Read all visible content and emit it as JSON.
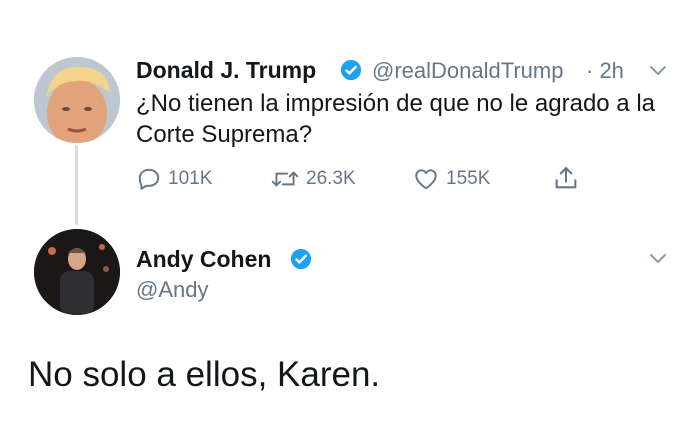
{
  "tweet": {
    "author_name": "Donald J. Trump",
    "handle": "@realDonaldTrump",
    "time": "· 2h",
    "text": "¿No tienen la impresión de que no le agrado a la Corte Suprema?",
    "replies": "101K",
    "retweets": "26.3K",
    "likes": "155K"
  },
  "reply": {
    "author_name": "Andy Cohen",
    "handle": "@Andy",
    "text": "No solo a ellos, Karen."
  },
  "icons": {
    "verified": "verified-badge-icon",
    "reply": "reply-icon",
    "retweet": "retweet-icon",
    "like": "heart-icon",
    "share": "share-icon",
    "menu": "chevron-down-icon"
  },
  "colors": {
    "verified": "#1da1f2",
    "muted": "#657786",
    "text": "#14171a"
  }
}
